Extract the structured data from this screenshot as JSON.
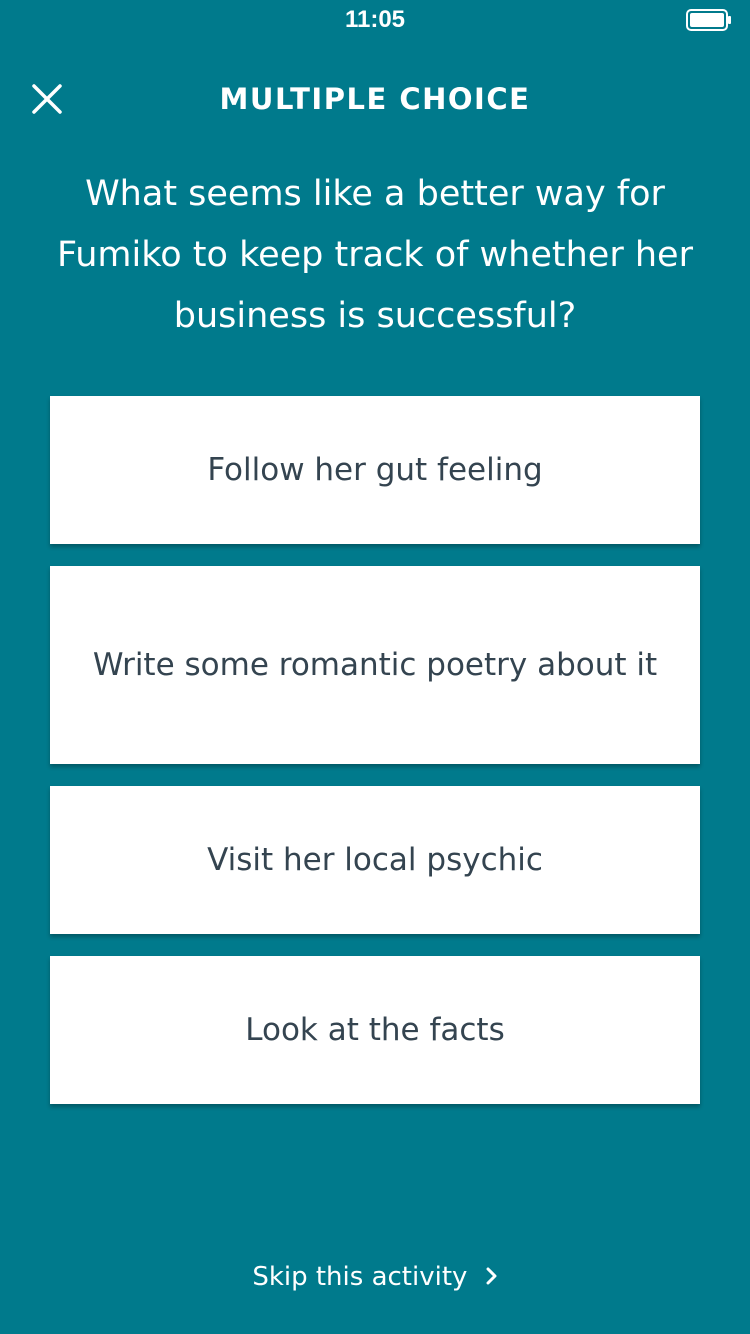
{
  "status_bar": {
    "time": "11:05",
    "battery_icon": "battery-full-icon"
  },
  "header": {
    "close_icon": "close-icon",
    "title": "MULTIPLE CHOICE"
  },
  "question": {
    "text": "What seems like a better way for Fumiko to keep track of whether her business is successful?"
  },
  "choices": [
    {
      "label": "Follow her gut feeling"
    },
    {
      "label": "Write some romantic poetry about it"
    },
    {
      "label": "Visit her local psychic"
    },
    {
      "label": "Look at the facts"
    }
  ],
  "footer": {
    "skip_label": "Skip this activity",
    "skip_icon": "chevron-right-icon"
  },
  "colors": {
    "background": "#007a8c",
    "card": "#ffffff",
    "card_text": "#344450",
    "header_text": "#ffffff"
  }
}
